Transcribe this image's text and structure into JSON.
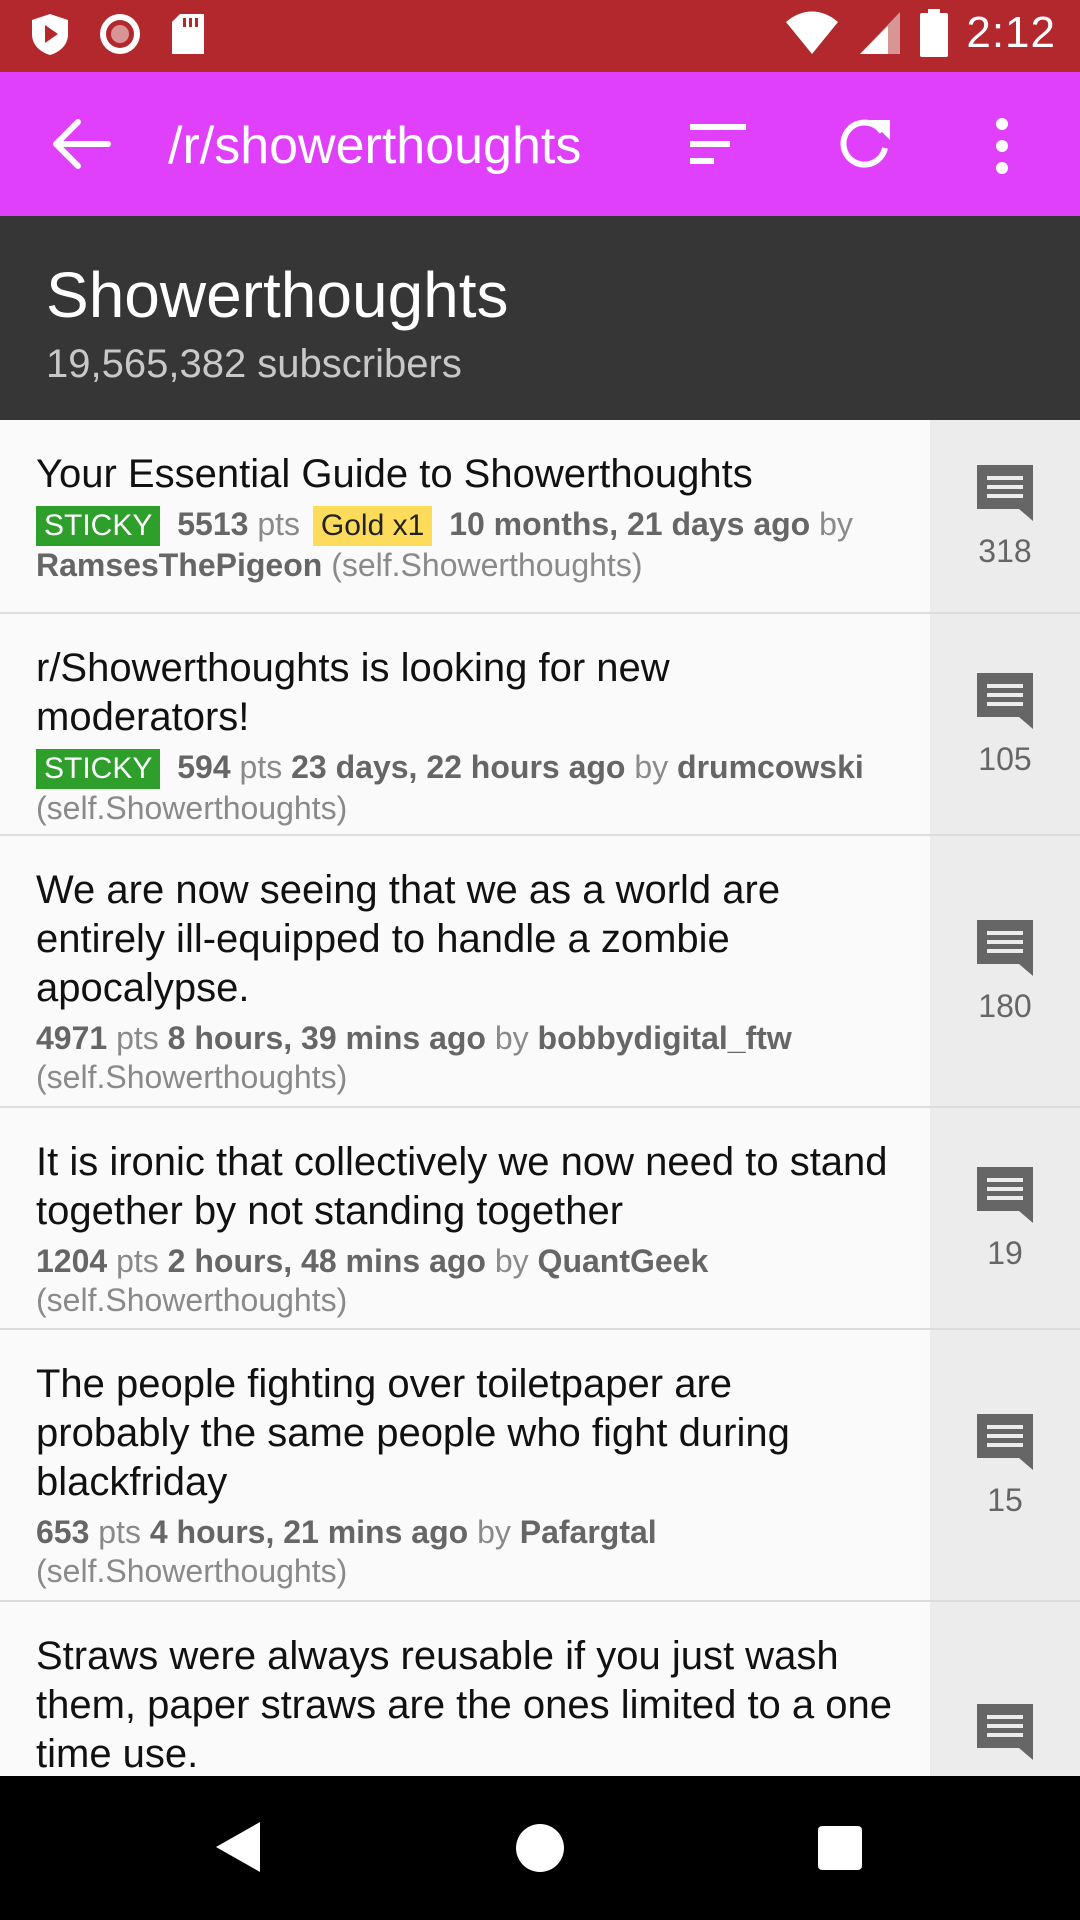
{
  "status_bar": {
    "time": "2:12",
    "icons": [
      "shield-play-icon",
      "record-icon",
      "sd-card-icon",
      "wifi-icon",
      "signal-icon",
      "battery-icon"
    ]
  },
  "app_bar": {
    "title": "/r/showerthoughts",
    "icons": [
      "back-arrow-icon",
      "sort-icon",
      "refresh-icon",
      "more-vert-icon"
    ]
  },
  "header": {
    "name": "Showerthoughts",
    "subscribers": "19,565,382 subscribers"
  },
  "colors": {
    "status_bar": "#b3282d",
    "app_bar": "#e040fb",
    "header": "#363636",
    "sticky": "#2e9f2b",
    "gold": "#fddc5c"
  },
  "posts": [
    {
      "title": "Your Essential Guide to Showerthoughts",
      "sticky": "STICKY",
      "points": "5513",
      "pts_label": "pts",
      "gold": "Gold x1",
      "age": "10 months, 21 days ago",
      "by": "by",
      "author": "RamsesThePigeon",
      "domain": "(self.Showerthoughts)",
      "comments": "318"
    },
    {
      "title": "r/Showerthoughts is looking for new moderators!",
      "sticky": "STICKY",
      "points": "594",
      "pts_label": "pts",
      "age": "23 days, 22 hours ago",
      "by": "by",
      "author": "drumcowski",
      "domain": "(self.Showerthoughts)",
      "comments": "105"
    },
    {
      "title": "We are now seeing that we as a world are entirely ill-equipped to handle a zombie apocalypse.",
      "points": "4971",
      "pts_label": "pts",
      "age": "8 hours, 39 mins ago",
      "by": "by",
      "author": "bobbydigital_ftw",
      "domain": "(self.Showerthoughts)",
      "comments": "180"
    },
    {
      "title": "It is ironic that collectively we now need to stand together by not standing together",
      "points": "1204",
      "pts_label": "pts",
      "age": "2 hours, 48 mins ago",
      "by": "by",
      "author": "QuantGeek",
      "domain": "(self.Showerthoughts)",
      "comments": "19"
    },
    {
      "title": "The people fighting over toiletpaper are probably the same people who fight during blackfriday",
      "points": "653",
      "pts_label": "pts",
      "age": "4 hours, 21 mins ago",
      "by": "by",
      "author": "Pafargtal",
      "domain": "(self.Showerthoughts)",
      "comments": "15"
    },
    {
      "title": "Straws were always reusable if you just wash them, paper straws are the ones limited to a one time use.",
      "comments": ""
    }
  ],
  "nav_bar": {
    "icons": [
      "back-triangle-icon",
      "home-circle-icon",
      "recents-square-icon"
    ]
  }
}
